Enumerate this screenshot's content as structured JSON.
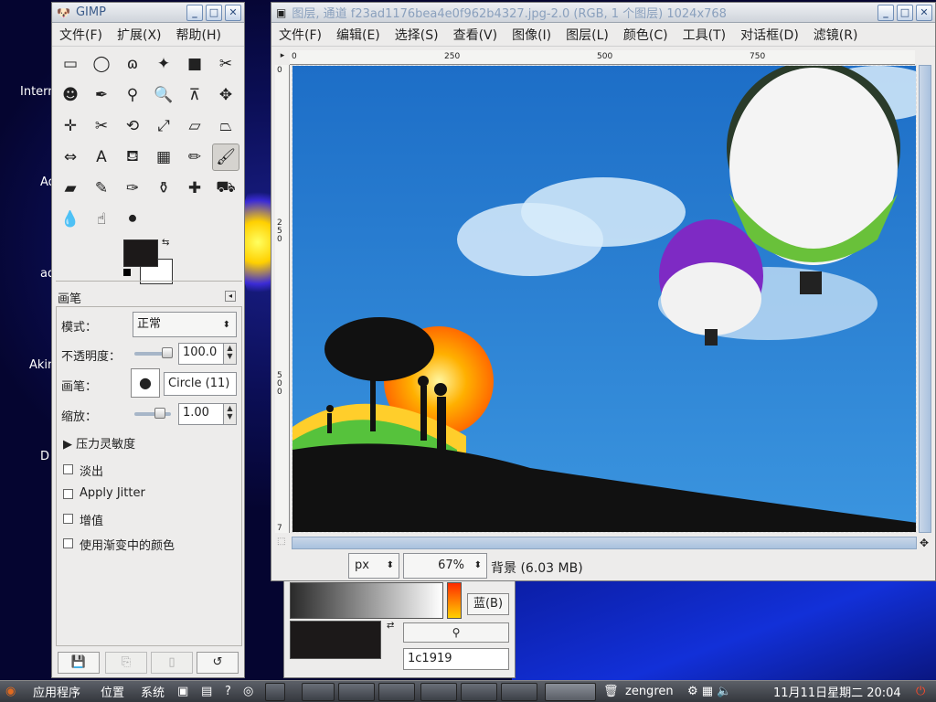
{
  "desktop": {
    "labels": [
      "Intern",
      "Ad",
      "ad",
      "Akin",
      "D"
    ]
  },
  "toolbox": {
    "title": "GIMP",
    "menu": [
      "文件(F)",
      "扩展(X)",
      "帮助(H)"
    ],
    "tools": [
      {
        "name": "rect-select-icon",
        "glyph": "▭"
      },
      {
        "name": "ellipse-select-icon",
        "glyph": "◯"
      },
      {
        "name": "lasso-icon",
        "glyph": "ɷ"
      },
      {
        "name": "magic-wand-icon",
        "glyph": "✦"
      },
      {
        "name": "color-select-icon",
        "glyph": "■"
      },
      {
        "name": "scissors-icon",
        "glyph": "✂"
      },
      {
        "name": "foreground-select-icon",
        "glyph": "☻"
      },
      {
        "name": "paths-icon",
        "glyph": "✒"
      },
      {
        "name": "color-picker-icon",
        "glyph": "⚲"
      },
      {
        "name": "zoom-icon",
        "glyph": "🔍"
      },
      {
        "name": "measure-icon",
        "glyph": "⊼"
      },
      {
        "name": "move-icon",
        "glyph": "✥"
      },
      {
        "name": "align-icon",
        "glyph": "✛"
      },
      {
        "name": "crop-icon",
        "glyph": "✂"
      },
      {
        "name": "rotate-icon",
        "glyph": "⟲"
      },
      {
        "name": "scale-icon",
        "glyph": "⤢"
      },
      {
        "name": "shear-icon",
        "glyph": "▱"
      },
      {
        "name": "perspective-icon",
        "glyph": "⏢"
      },
      {
        "name": "flip-icon",
        "glyph": "⇔"
      },
      {
        "name": "text-icon",
        "glyph": "A"
      },
      {
        "name": "bucket-fill-icon",
        "glyph": "⛾"
      },
      {
        "name": "blend-icon",
        "glyph": "▦"
      },
      {
        "name": "pencil-icon",
        "glyph": "✏"
      },
      {
        "name": "paintbrush-icon",
        "glyph": "🖌"
      },
      {
        "name": "eraser-icon",
        "glyph": "▰"
      },
      {
        "name": "airbrush-icon",
        "glyph": "✎"
      },
      {
        "name": "ink-icon",
        "glyph": "✑"
      },
      {
        "name": "clone-icon",
        "glyph": "⚱"
      },
      {
        "name": "heal-icon",
        "glyph": "✚"
      },
      {
        "name": "perspective-clone-icon",
        "glyph": "⛟"
      },
      {
        "name": "blur-icon",
        "glyph": "💧"
      },
      {
        "name": "smudge-icon",
        "glyph": "☝"
      },
      {
        "name": "dodge-burn-icon",
        "glyph": "⚫"
      }
    ],
    "fg_color": "#1c1919",
    "bg_color": "#ffffff",
    "options": {
      "tool_name": "画笔",
      "mode_label": "模式：",
      "mode_value": "正常",
      "opacity_label": "不透明度：",
      "opacity_value": "100.0",
      "opacity": 1.0,
      "brush_label": "画笔：",
      "brush_value": "Circle (11)",
      "scale_label": "缩放：",
      "scale_value": "1.00",
      "scale": 0.2,
      "pressure_label": "压力灵敏度",
      "checkboxes": [
        "淡出",
        "Apply Jitter",
        "增值",
        "使用渐变中的颜色"
      ]
    }
  },
  "image_window": {
    "title": "图层, 通道 f23ad1176bea4e0f962b4327.jpg-2.0 (RGB, 1 个图层) 1024x768",
    "menu": [
      "文件(F)",
      "编辑(E)",
      "选择(S)",
      "查看(V)",
      "图像(I)",
      "图层(L)",
      "颜色(C)",
      "工具(T)",
      "对话框(D)",
      "滤镜(R)"
    ],
    "hruler": [
      "0",
      "250",
      "500",
      "750"
    ],
    "vruler": [
      "0",
      "250",
      "500",
      "7"
    ],
    "unit": "px",
    "zoom": "67%",
    "status": "背景 (6.03 MB)"
  },
  "color_dialog": {
    "channel_button": "蓝(B)",
    "hex_value": "1c1919"
  },
  "taskbar": {
    "apps": "应用程序",
    "places": "位置",
    "system": "系统",
    "user": "zengren",
    "datetime": "11月11日星期二  20:04"
  }
}
